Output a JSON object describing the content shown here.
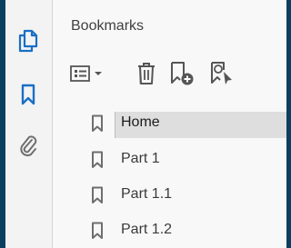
{
  "panel": {
    "title": "Bookmarks"
  },
  "rail": {
    "items": [
      {
        "name": "pages-icon",
        "selected": false
      },
      {
        "name": "bookmark-icon",
        "selected": true
      },
      {
        "name": "attachment-icon",
        "selected": false
      }
    ]
  },
  "toolbar": {
    "buttons": [
      {
        "name": "options-menu-icon"
      },
      {
        "name": "delete-icon"
      },
      {
        "name": "new-bookmark-icon"
      },
      {
        "name": "find-bookmark-icon"
      }
    ]
  },
  "bookmarks": [
    {
      "label": "Home",
      "selected": true
    },
    {
      "label": "Part 1",
      "selected": false
    },
    {
      "label": "Part 1.1",
      "selected": false
    },
    {
      "label": "Part 1.2",
      "selected": false
    }
  ],
  "colors": {
    "accent": "#1a6fc4",
    "frame": "#0c3f5e",
    "icon_gray": "#6e6e6e",
    "selection": "#dedede"
  }
}
